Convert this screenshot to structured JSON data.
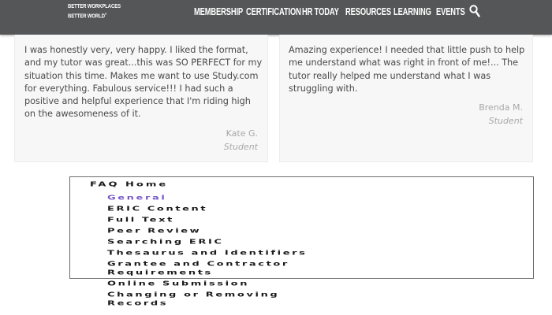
{
  "logo": {
    "line1": "BETTER WORKPLACES",
    "line2": "BETTER WORLD",
    "mark": "®"
  },
  "nav": {
    "items": [
      {
        "label": "MEMBERSHIP"
      },
      {
        "label": "CERTIFICATION"
      },
      {
        "label": "HR TODAY"
      },
      {
        "label": "RESOURCES"
      },
      {
        "label": "LEARNING"
      },
      {
        "label": "EVENTS"
      }
    ],
    "search_icon": "search-icon"
  },
  "testimonials": [
    {
      "quote": "I was honestly very, very happy. I liked the format, and my tutor was great...this was SO PERFECT for my situation this time. Makes me want to use Study.com for everything. Fabulous service!!! I had such a positive and helpful experience that I'm riding high on the awesomeness of it.",
      "author": "Kate G.",
      "role": "Student"
    },
    {
      "quote": "Amazing experience! I needed that little push to help me understand what was right in front of me!... The tutor really helped me understand what I was struggling with.",
      "author": "Brenda M.",
      "role": "Student"
    }
  ],
  "faq": {
    "title": "FAQ Home",
    "links": [
      {
        "label": "General"
      },
      {
        "label": "ERIC Content"
      },
      {
        "label": "Full Text"
      },
      {
        "label": "Peer Review"
      },
      {
        "label": "Searching ERIC"
      },
      {
        "label": "Thesaurus and Identifiers"
      },
      {
        "label": "Grantee and Contractor"
      },
      {
        "label": "Requirements"
      },
      {
        "label": "Online Submission"
      },
      {
        "label": "Changing or Removing"
      },
      {
        "label": "Records"
      }
    ]
  },
  "colors": {
    "navbar": "#555657",
    "card": "#f7f7f7",
    "active_link": "#7a58c8"
  }
}
